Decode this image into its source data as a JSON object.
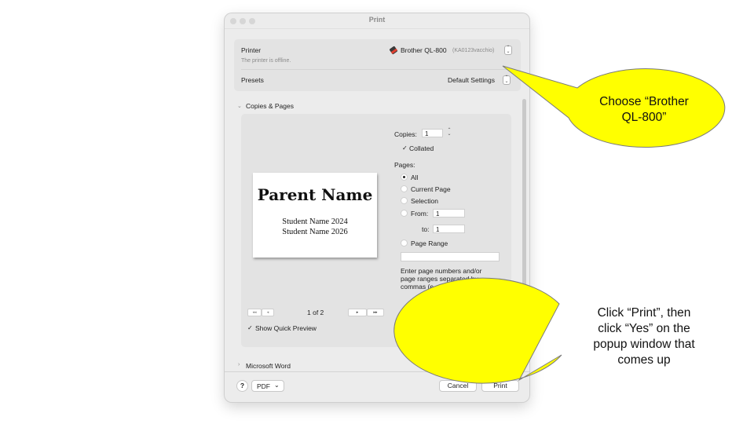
{
  "dialog": {
    "title": "Print",
    "printer_label": "Printer",
    "printer_status": "The printer is offline.",
    "printer_name": "Brother QL-800",
    "printer_id": "(KA0123vacchio)",
    "presets_label": "Presets",
    "presets_value": "Default Settings",
    "section_copies_pages": "Copies & Pages",
    "copies_label": "Copies:",
    "copies_value": "1",
    "collated_label": "Collated",
    "pages_label": "Pages:",
    "pages_options": {
      "all": "All",
      "current": "Current Page",
      "selection": "Selection",
      "from": "From:",
      "to": "to:",
      "range": "Page Range"
    },
    "from_value": "1",
    "to_value": "1",
    "page_range_value": "",
    "range_help": [
      "Enter page numbers and/or",
      "page ranges separated by",
      "commas (e.g. 2, 5-8)"
    ],
    "page_indicator": "1 of 2",
    "quick_preview_label": "Show Quick Preview",
    "section_word": "Microsoft Word",
    "help_label": "?",
    "pdf_label": "PDF",
    "cancel_label": "Cancel",
    "print_label": "Print",
    "nav": {
      "first": "◂◂",
      "prev": "◂",
      "next": "▸",
      "last": "▸▸"
    }
  },
  "preview": {
    "heading": "Parent Name",
    "line1": "Student Name 2024",
    "line2": "Student Name 2026"
  },
  "callouts": {
    "top": [
      "Choose “Brother",
      "QL-800”"
    ],
    "bottom": [
      "Click “Print”, then",
      "click “Yes” on the",
      "popup window that",
      "comes up"
    ],
    "fill": "#ffff00"
  }
}
